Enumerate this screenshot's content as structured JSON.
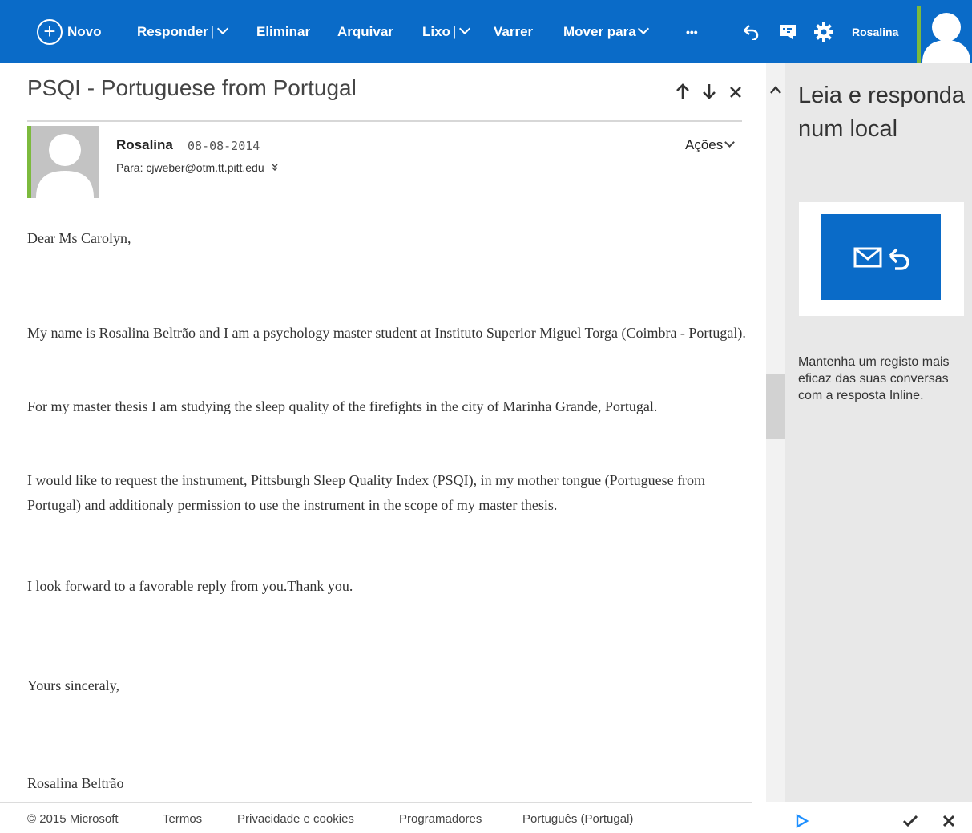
{
  "toolbar": {
    "new_label": "Novo",
    "reply_label": "Responder",
    "delete_label": "Eliminar",
    "archive_label": "Arquivar",
    "junk_label": "Lixo",
    "sweep_label": "Varrer",
    "move_label": "Mover para",
    "more_label": "•••",
    "separator": "|",
    "user_name": "Rosalina",
    "accent_color": "#0a6bc8"
  },
  "message": {
    "subject": "PSQI - Portuguese from Portugal",
    "sender": "Rosalina",
    "date": "08-08-2014",
    "recipient": "Para: cjweber@otm.tt.pitt.edu",
    "actions_label": "Ações",
    "body": {
      "greeting": "Dear Ms Carolyn,",
      "p1": "My name is Rosalina Beltrão and I am a psychology master student at Instituto Superior Miguel Torga  (Coimbra - Portugal).",
      "p2": " For my master thesis I am studying the sleep quality of the firefights in the city of Marinha Grande, Portugal.",
      "p3": "I would like to request the instrument, Pittsburgh Sleep Quality Index (PSQI), in my mother tongue (Portuguese from Portugal) and additionaly permission to use the instrument in the scope of my master thesis.",
      "p4": "I look forward to a favorable reply from you.Thank you.",
      "closing": "Yours sinceraly,",
      "signature": "Rosalina Beltrão"
    }
  },
  "side_panel": {
    "title": "Leia e responda num local",
    "description": "Mantenha um registo mais eficaz das suas conversas com a resposta Inline."
  },
  "footer": {
    "copyright": "© 2015 Microsoft",
    "terms": "Termos",
    "privacy": "Privacidade e cookies",
    "developers": "Programadores",
    "language": "Português (Portugal)"
  },
  "icons": [
    "plus-circle-icon",
    "chevron-down-icon",
    "undo-icon",
    "chat-icon",
    "gear-icon",
    "avatar-icon",
    "arrow-up-icon",
    "arrow-down-icon",
    "close-icon",
    "expand-icon",
    "caret-up-icon",
    "mail-reply-icon",
    "play-icon",
    "check-icon"
  ]
}
